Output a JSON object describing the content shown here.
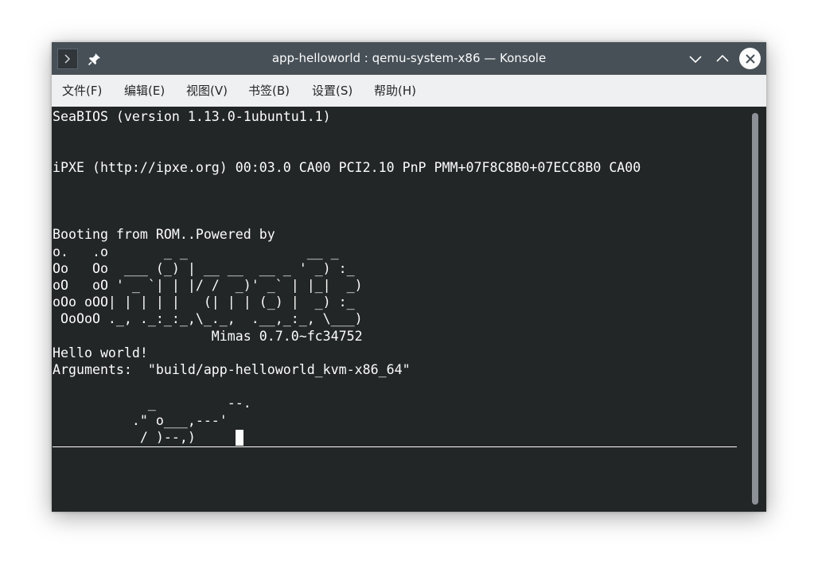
{
  "window": {
    "title": "app-helloworld : qemu-system-x86 — Konsole"
  },
  "menubar": {
    "items": [
      {
        "label": "文件(F)"
      },
      {
        "label": "编辑(E)"
      },
      {
        "label": "视图(V)"
      },
      {
        "label": "书签(B)"
      },
      {
        "label": "设置(S)"
      },
      {
        "label": "帮助(H)"
      }
    ]
  },
  "terminal": {
    "output": "SeaBIOS (version 1.13.0-1ubuntu1.1)\n\n\niPXE (http://ipxe.org) 00:03.0 CA00 PCI2.10 PnP PMM+07F8C8B0+07ECC8B0 CA00\n\n\n\nBooting from ROM..Powered by\no.   .o       _ _               __ _\nOo   Oo  ___ (_) | __ __  __ _ ' _) :_\noO   oO ' _ `| | |/ /  _)' _` | |_|  _)\noOo oOO| | | | |   (| | | (_) |  _) :_\n OoOoO ._, ._:_:_,\\_._,  .__,_:_, \\___)\n                    Mimas 0.7.0~fc34752\nHello world!\nArguments:  \"build/app-helloworld_kvm-x86_64\"\n\n            _         --.\n          .\" o___,---'\n           / )--,)"
  },
  "icons": {
    "app": "terminal-icon",
    "pin": "pin-icon",
    "minimize": "chevron-down-icon",
    "maximize": "chevron-up-icon",
    "close": "close-icon"
  },
  "colors": {
    "titlebar": "#475057",
    "menubar": "#eff0f1",
    "terminal_bg": "#232627",
    "terminal_fg": "#fcfcfc"
  }
}
